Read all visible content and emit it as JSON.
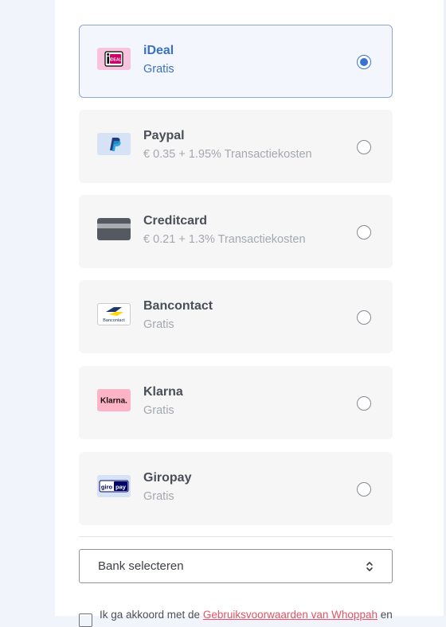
{
  "payment_methods": [
    {
      "name": "iDeal",
      "subtitle": "Gratis",
      "icon": "ideal-logo-icon",
      "selected": true
    },
    {
      "name": "Paypal",
      "subtitle": "€ 0.35 + 1.95% Transactiekosten",
      "icon": "paypal-logo-icon",
      "selected": false
    },
    {
      "name": "Creditcard",
      "subtitle": "€ 0.21 + 1.3% Transactiekosten",
      "icon": "creditcard-icon",
      "selected": false
    },
    {
      "name": "Bancontact",
      "subtitle": "Gratis",
      "icon": "bancontact-logo-icon",
      "selected": false
    },
    {
      "name": "Klarna",
      "subtitle": "Gratis",
      "icon": "klarna-logo-icon",
      "selected": false
    },
    {
      "name": "Giropay",
      "subtitle": "Gratis",
      "icon": "giropay-logo-icon",
      "selected": false
    }
  ],
  "logo_text": {
    "ideal": "iDEAL",
    "bancontact": "Bancontact",
    "klarna": "Klarna.",
    "giropay_left": "giro",
    "giropay_right": "pay"
  },
  "bank_select": {
    "label": "Bank selecteren"
  },
  "terms": {
    "prefix": "Ik ga akkoord met de",
    "link": "Gebruiksvoorwaarden van Whoppah",
    "suffix": "en"
  },
  "colors": {
    "selected_accent": "#3b72d1",
    "link": "#e25563",
    "ideal_pink": "#f8c3dc",
    "paypal_bg": "#d6e2f5",
    "klarna_pink": "#ffb3c7"
  }
}
